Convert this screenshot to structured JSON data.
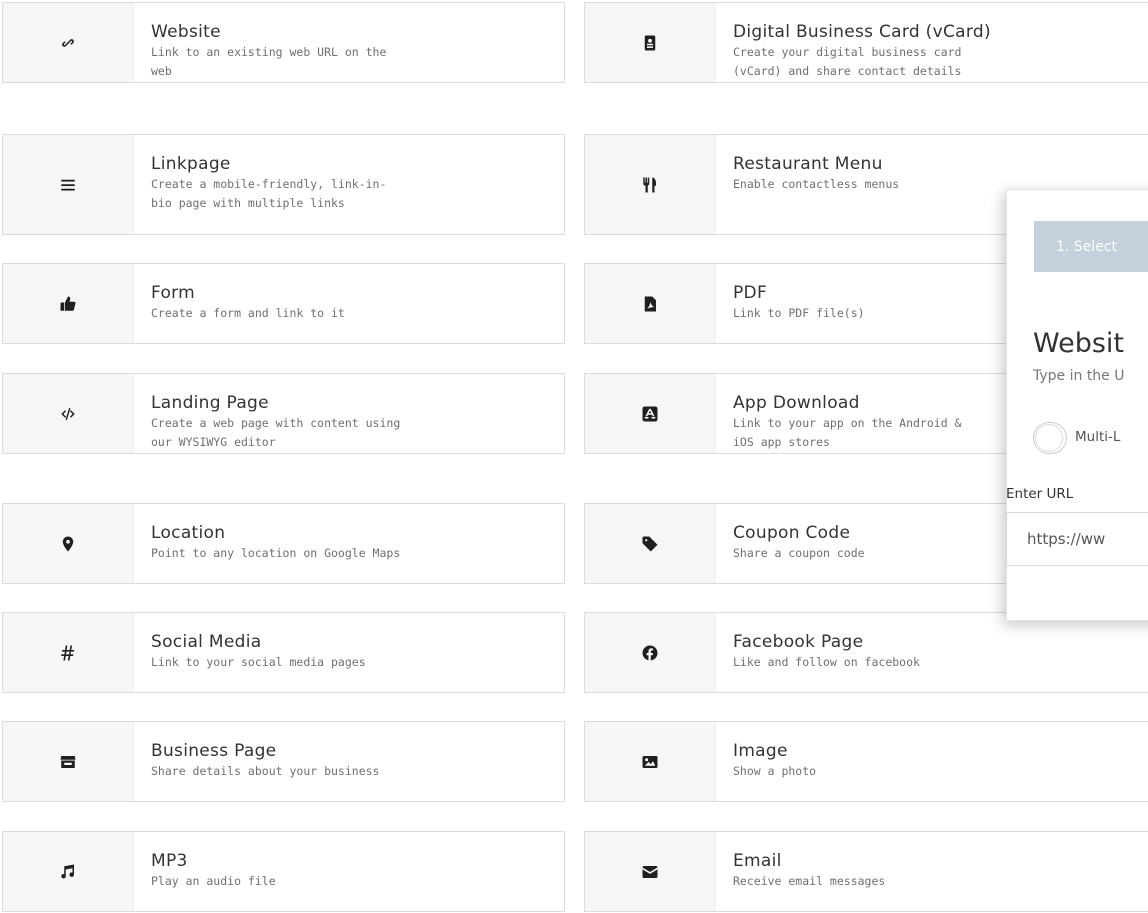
{
  "cards": [
    {
      "title": "Website",
      "desc": "Link to an existing web URL on the web",
      "icon": "link-icon"
    },
    {
      "title": "Digital Business Card (vCard)",
      "desc": "Create your digital business card (vCard) and share contact details",
      "icon": "vcard-icon"
    },
    {
      "title": "Linkpage",
      "desc": "Create a mobile-friendly, link-in-bio page with multiple links",
      "icon": "menu-lines-icon"
    },
    {
      "title": "Restaurant Menu",
      "desc": "Enable contactless menus",
      "icon": "utensils-icon"
    },
    {
      "title": "Form",
      "desc": "Create a form and link to it",
      "icon": "thumbs-up-icon"
    },
    {
      "title": "PDF",
      "desc": "Link to PDF file(s)",
      "icon": "pdf-icon"
    },
    {
      "title": "Landing Page",
      "desc": "Create a web page with content using our WYSIWYG editor",
      "icon": "code-icon"
    },
    {
      "title": "App Download",
      "desc": "Link to your app on the Android & iOS app stores",
      "icon": "app-store-icon"
    },
    {
      "title": "Location",
      "desc": "Point to any location on Google Maps",
      "icon": "map-pin-icon"
    },
    {
      "title": "Coupon Code",
      "desc": "Share a coupon code",
      "icon": "tag-icon"
    },
    {
      "title": "Social Media",
      "desc": "Link to your social media pages",
      "icon": "hashtag-icon"
    },
    {
      "title": "Facebook Page",
      "desc": "Like and follow on facebook",
      "icon": "facebook-icon"
    },
    {
      "title": "Business Page",
      "desc": "Share details about your business",
      "icon": "store-icon"
    },
    {
      "title": "Image",
      "desc": "Show a photo",
      "icon": "image-icon"
    },
    {
      "title": "MP3",
      "desc": "Play an audio file",
      "icon": "music-note-icon"
    },
    {
      "title": "Email",
      "desc": "Receive email messages",
      "icon": "envelope-icon"
    }
  ],
  "overlay": {
    "step_label": "1. Select",
    "title": "Websit",
    "subtitle": "Type in the U",
    "toggle_label": "Multi-L",
    "url_label": "Enter URL",
    "url_value": "https://ww"
  },
  "colors": {
    "icon_box": "#f5f6f8",
    "step_button": "#c4d0dc",
    "border": "#dcdcdc"
  }
}
